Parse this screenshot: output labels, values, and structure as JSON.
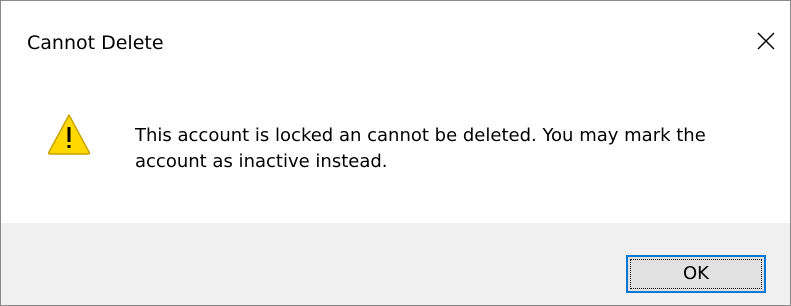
{
  "window": {
    "title": "Cannot Delete"
  },
  "message": {
    "text": "This account is locked an cannot be deleted. You may mark the account as inactive instead.",
    "icon": "warning-icon"
  },
  "buttons": {
    "ok_label": "OK"
  },
  "colors": {
    "warning_yellow": "#FFD800",
    "warning_outline": "#C9A300",
    "footer_bg": "#F0F0F0",
    "button_bg": "#E1E1E1",
    "button_focus_border": "#0078D7"
  }
}
